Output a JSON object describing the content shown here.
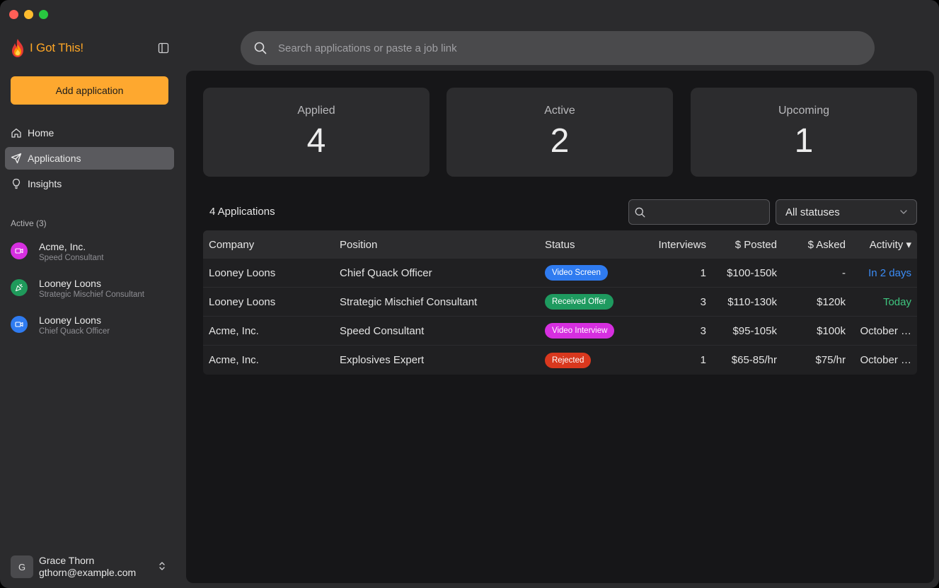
{
  "app": {
    "name": "I Got This!"
  },
  "sidebar": {
    "add_label": "Add application",
    "nav": [
      {
        "label": "Home",
        "icon": "home-icon"
      },
      {
        "label": "Applications",
        "icon": "send-icon",
        "active": true
      },
      {
        "label": "Insights",
        "icon": "lightbulb-icon"
      }
    ],
    "active_section": "Active (3)",
    "active_items": [
      {
        "company": "Acme, Inc.",
        "position": "Speed Consultant",
        "color": "#d62fe0",
        "icon": "video-icon"
      },
      {
        "company": "Looney Loons",
        "position": "Strategic Mischief Consultant",
        "color": "#1f9a5b",
        "icon": "party-popper-icon"
      },
      {
        "company": "Looney Loons",
        "position": "Chief Quack Officer",
        "color": "#2f7bf0",
        "icon": "video-icon"
      }
    ],
    "user": {
      "initial": "G",
      "name": "Grace Thorn",
      "email": "gthorn@example.com"
    }
  },
  "search": {
    "placeholder": "Search applications or paste a job link"
  },
  "stats": [
    {
      "label": "Applied",
      "value": "4"
    },
    {
      "label": "Active",
      "value": "2"
    },
    {
      "label": "Upcoming",
      "value": "1"
    }
  ],
  "list": {
    "title": "4 Applications",
    "filter_placeholder": "",
    "status_filter": "All statuses"
  },
  "table": {
    "columns": [
      "Company",
      "Position",
      "Status",
      "Interviews",
      "$ Posted",
      "$ Asked",
      "Activity ▾"
    ],
    "rows": [
      {
        "company": "Looney Loons",
        "position": "Chief Quack Officer",
        "status": "Video Screen",
        "status_color": "#2f7bf0",
        "interviews": "1",
        "posted": "$100-150k",
        "asked": "-",
        "activity": "In 2 days",
        "activity_color": "#3b8cf5"
      },
      {
        "company": "Looney Loons",
        "position": "Strategic Mischief Consultant",
        "status": "Received Offer",
        "status_color": "#1e9a5f",
        "interviews": "3",
        "posted": "$110-130k",
        "asked": "$120k",
        "activity": "Today",
        "activity_color": "#3fc57f"
      },
      {
        "company": "Acme, Inc.",
        "position": "Speed Consultant",
        "status": "Video Interview",
        "status_color": "#d62fe0",
        "interviews": "3",
        "posted": "$95-105k",
        "asked": "$100k",
        "activity": "October …",
        "activity_color": "#e4e4e4"
      },
      {
        "company": "Acme, Inc.",
        "position": "Explosives Expert",
        "status": "Rejected",
        "status_color": "#d9381e",
        "interviews": "1",
        "posted": "$65-85/hr",
        "asked": "$75/hr",
        "activity": "October …",
        "activity_color": "#e4e4e4"
      }
    ]
  },
  "colors": {
    "accent": "#fea82f"
  }
}
